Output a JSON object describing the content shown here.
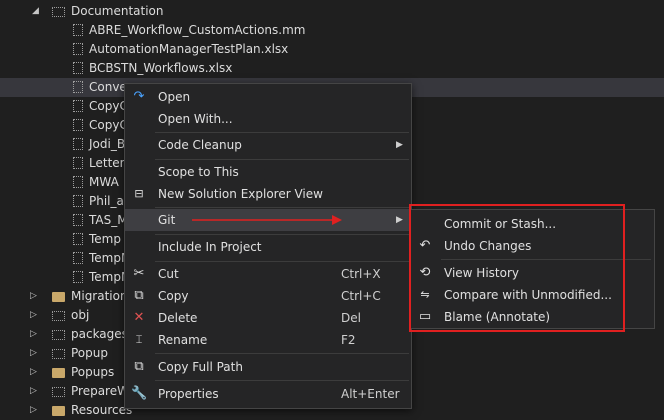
{
  "tree": {
    "items": [
      {
        "label": "Documentation",
        "kind": "folder-open",
        "indent": 0
      },
      {
        "label": "ABRE_Workflow_CustomActions.mm",
        "kind": "file",
        "indent": 1
      },
      {
        "label": "AutomationManagerTestPlan.xlsx",
        "kind": "file",
        "indent": 1
      },
      {
        "label": "BCBSTN_Workflows.xlsx",
        "kind": "file",
        "indent": 1
      },
      {
        "label": "Conve",
        "kind": "file",
        "indent": 1
      },
      {
        "label": "CopyC",
        "kind": "file",
        "indent": 1
      },
      {
        "label": "CopyC",
        "kind": "file",
        "indent": 1
      },
      {
        "label": "Jodi_B",
        "kind": "file",
        "indent": 1
      },
      {
        "label": "Letters",
        "kind": "file",
        "indent": 1
      },
      {
        "label": "MWA",
        "kind": "file",
        "indent": 1
      },
      {
        "label": "Phil_as",
        "kind": "file",
        "indent": 1
      },
      {
        "label": "TAS_M",
        "kind": "file",
        "indent": 1
      },
      {
        "label": "Temp I",
        "kind": "file",
        "indent": 1
      },
      {
        "label": "TempM",
        "kind": "file",
        "indent": 1
      },
      {
        "label": "TempM",
        "kind": "file",
        "indent": 1
      },
      {
        "label": "Migration",
        "kind": "folder",
        "indent": 0
      },
      {
        "label": "obj",
        "kind": "folder-empty",
        "indent": 0
      },
      {
        "label": "packages",
        "kind": "folder-empty",
        "indent": 0
      },
      {
        "label": "Popup",
        "kind": "folder-empty",
        "indent": 0
      },
      {
        "label": "Popups",
        "kind": "folder",
        "indent": 0
      },
      {
        "label": "PrepareW",
        "kind": "folder-empty",
        "indent": 0
      },
      {
        "label": "Resources",
        "kind": "folder",
        "indent": 0
      }
    ]
  },
  "context_menu": {
    "items": [
      {
        "label": "Open",
        "icon": "open-redo-icon"
      },
      {
        "label": "Open With...",
        "icon": ""
      },
      {
        "label": "Code Cleanup",
        "icon": "",
        "submenu": true
      },
      {
        "label": "Scope to This",
        "icon": ""
      },
      {
        "label": "New Solution Explorer View",
        "icon": "new-view-icon"
      },
      {
        "label": "Git",
        "icon": "",
        "submenu": true
      },
      {
        "label": "Include In Project",
        "icon": ""
      },
      {
        "label": "Cut",
        "icon": "scissors-icon",
        "shortcut": "Ctrl+X"
      },
      {
        "label": "Copy",
        "icon": "copy-icon",
        "shortcut": "Ctrl+C"
      },
      {
        "label": "Delete",
        "icon": "delete-x-icon",
        "shortcut": "Del"
      },
      {
        "label": "Rename",
        "icon": "rename-icon",
        "shortcut": "F2"
      },
      {
        "label": "Copy Full Path",
        "icon": "copy-path-icon"
      },
      {
        "label": "Properties",
        "icon": "wrench-icon",
        "shortcut": "Alt+Enter"
      }
    ],
    "submenu_glyph": "▶"
  },
  "git_submenu": {
    "items": [
      {
        "label": "Commit or Stash...",
        "icon": ""
      },
      {
        "label": "Undo Changes",
        "icon": "undo-icon"
      },
      {
        "label": "View History",
        "icon": "history-icon"
      },
      {
        "label": "Compare with Unmodified...",
        "icon": "compare-icon"
      },
      {
        "label": "Blame (Annotate)",
        "icon": "blame-icon"
      }
    ]
  },
  "colors": {
    "menu_bg": "#252526",
    "highlight": "#e02020",
    "folder": "#c9a86a",
    "open_icon": "#4aa3ff",
    "delete_icon": "#e05252"
  }
}
